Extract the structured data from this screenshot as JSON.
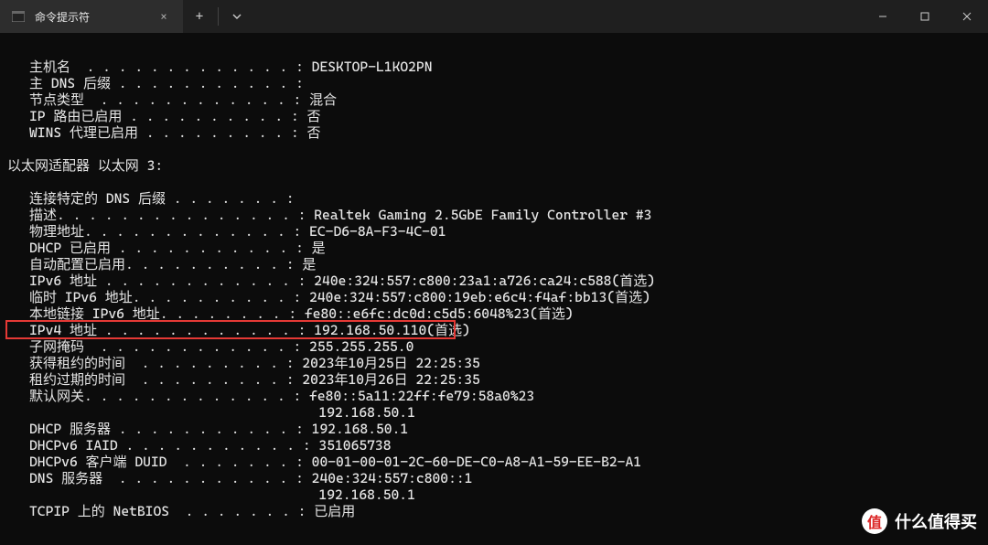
{
  "window": {
    "tab_title": "命令提示符",
    "new_tab_glyph": "+",
    "close_glyph": "×"
  },
  "terminal": {
    "header_lines": [
      {
        "k": "主机名  . . . . . . . . . . . . . : ",
        "v": "DESKTOP-L1KO2PN"
      },
      {
        "k": "主 DNS 后缀 . . . . . . . . . . . : ",
        "v": ""
      },
      {
        "k": "节点类型  . . . . . . . . . . . . : ",
        "v": "混合"
      },
      {
        "k": "IP 路由已启用 . . . . . . . . . . : ",
        "v": "否"
      },
      {
        "k": "WINS 代理已启用 . . . . . . . . . : ",
        "v": "否"
      }
    ],
    "adapter_title": "以太网适配器 以太网 3:",
    "adapter_lines": [
      {
        "k": "连接特定的 DNS 后缀 . . . . . . . : ",
        "v": ""
      },
      {
        "k": "描述. . . . . . . . . . . . . . . : ",
        "v": "Realtek Gaming 2.5GbE Family Controller #3"
      },
      {
        "k": "物理地址. . . . . . . . . . . . . : ",
        "v": "EC-D6-8A-F3-4C-01"
      },
      {
        "k": "DHCP 已启用 . . . . . . . . . . . : ",
        "v": "是"
      },
      {
        "k": "自动配置已启用. . . . . . . . . . : ",
        "v": "是"
      },
      {
        "k": "IPv6 地址 . . . . . . . . . . . . : ",
        "v": "240e:324:557:c800:23a1:a726:ca24:c588(首选)"
      },
      {
        "k": "临时 IPv6 地址. . . . . . . . . . : ",
        "v": "240e:324:557:c800:19eb:e6c4:f4af:bb13(首选)"
      },
      {
        "k": "本地链接 IPv6 地址. . . . . . . . : ",
        "v": "fe80::e6fc:dc0d:c5d5:6048%23(首选)"
      },
      {
        "k": "IPv4 地址 . . . . . . . . . . . . : ",
        "v": "192.168.50.110(首选)"
      },
      {
        "k": "子网掩码  . . . . . . . . . . . . : ",
        "v": "255.255.255.0"
      },
      {
        "k": "获得租约的时间  . . . . . . . . . : ",
        "v": "2023年10月25日 22:25:35"
      },
      {
        "k": "租约过期的时间  . . . . . . . . . : ",
        "v": "2023年10月26日 22:25:35"
      },
      {
        "k": "默认网关. . . . . . . . . . . . . : ",
        "v": "fe80::5a11:22ff:fe79:58a0%23"
      },
      {
        "k": "                                    ",
        "v": "192.168.50.1"
      },
      {
        "k": "DHCP 服务器 . . . . . . . . . . . : ",
        "v": "192.168.50.1"
      },
      {
        "k": "DHCPv6 IAID . . . . . . . . . . . : ",
        "v": "351065738"
      },
      {
        "k": "DHCPv6 客户端 DUID  . . . . . . . : ",
        "v": "00-01-00-01-2C-60-DE-C0-A8-A1-59-EE-B2-A1"
      },
      {
        "k": "DNS 服务器  . . . . . . . . . . . : ",
        "v": "240e:324:557:c800::1"
      },
      {
        "k": "                                    ",
        "v": "192.168.50.1"
      },
      {
        "k": "TCPIP 上的 NetBIOS  . . . . . . . : ",
        "v": "已启用"
      }
    ],
    "highlight_index": 8
  },
  "watermark": {
    "glyph": "值",
    "text": "什么值得买"
  }
}
